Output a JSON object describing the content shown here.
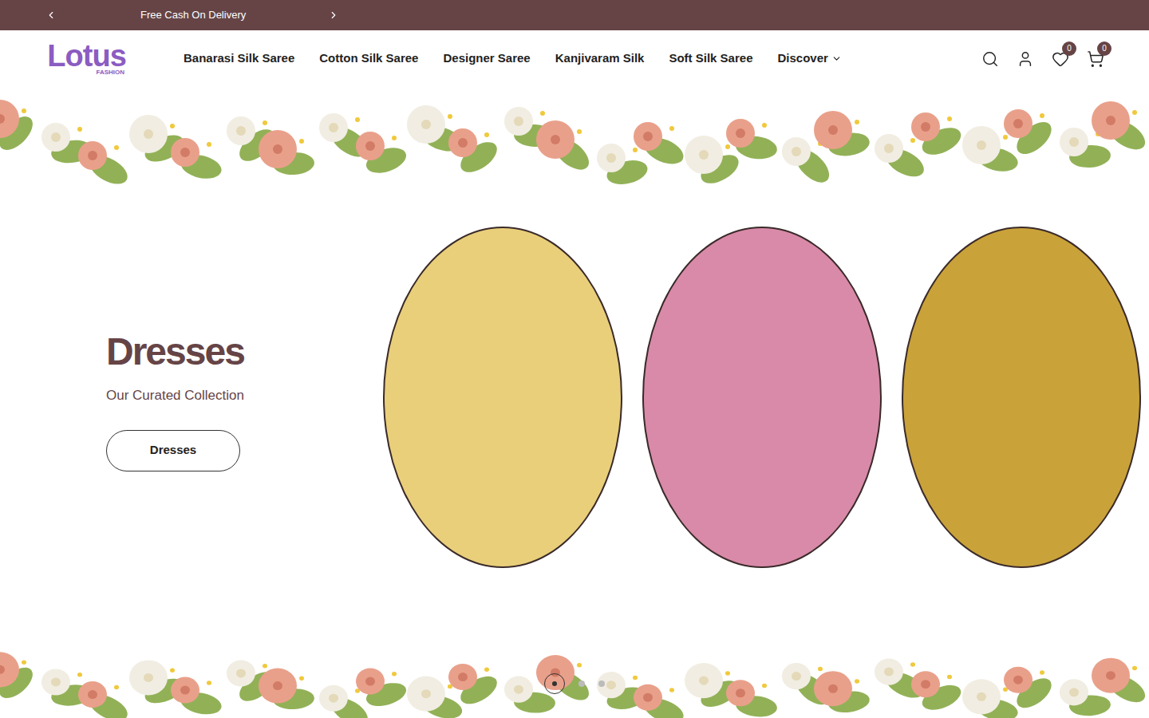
{
  "announcement": {
    "text": "Free Cash On Delivery"
  },
  "logo": {
    "name": "Lotus",
    "tagline": "FASHION"
  },
  "nav": [
    {
      "label": "Banarasi Silk Saree",
      "dropdown": false
    },
    {
      "label": "Cotton Silk Saree",
      "dropdown": false
    },
    {
      "label": "Designer Saree",
      "dropdown": false
    },
    {
      "label": "Kanjivaram Silk",
      "dropdown": false
    },
    {
      "label": "Soft Silk Saree",
      "dropdown": false
    },
    {
      "label": "Discover",
      "dropdown": true
    }
  ],
  "header_icons": {
    "wishlist_count": "0",
    "cart_count": "0"
  },
  "hero": {
    "title": "Dresses",
    "subtitle": "Our Curated Collection",
    "button": "Dresses",
    "images": 3
  },
  "slider_dots": [
    {
      "selected": true
    },
    {
      "selected": false
    },
    {
      "selected": false
    }
  ]
}
